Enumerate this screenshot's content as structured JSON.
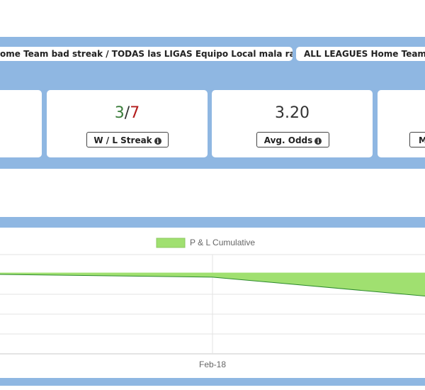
{
  "tabs": [
    {
      "label": "ome Team bad streak / TODAS las LIGAS Equipo Local mala racha"
    },
    {
      "label": "ALL LEAGUES Home Team b"
    }
  ],
  "stats": {
    "streak": {
      "wins": "3",
      "sep": "/",
      "losses": "7",
      "label": "W / L Streak"
    },
    "odds": {
      "value": "3.20",
      "label": "Avg. Odds"
    },
    "partial_label": "M"
  },
  "colors": {
    "band": "#8fb7e2",
    "win": "#3c7d3c",
    "loss": "#b31b1b",
    "area_fill": "#a0e070",
    "line": "#2d8a2d"
  },
  "chart_data": {
    "type": "area",
    "title": "",
    "legend": {
      "label": "P & L Cumulative",
      "placement": "top"
    },
    "x_ticks": [
      "Feb-18"
    ],
    "series": [
      {
        "name": "P & L Cumulative",
        "values": [
          -0.1,
          -0.25,
          -1.3
        ]
      }
    ],
    "ylim": [
      -4.5,
      1
    ],
    "grid": true
  }
}
